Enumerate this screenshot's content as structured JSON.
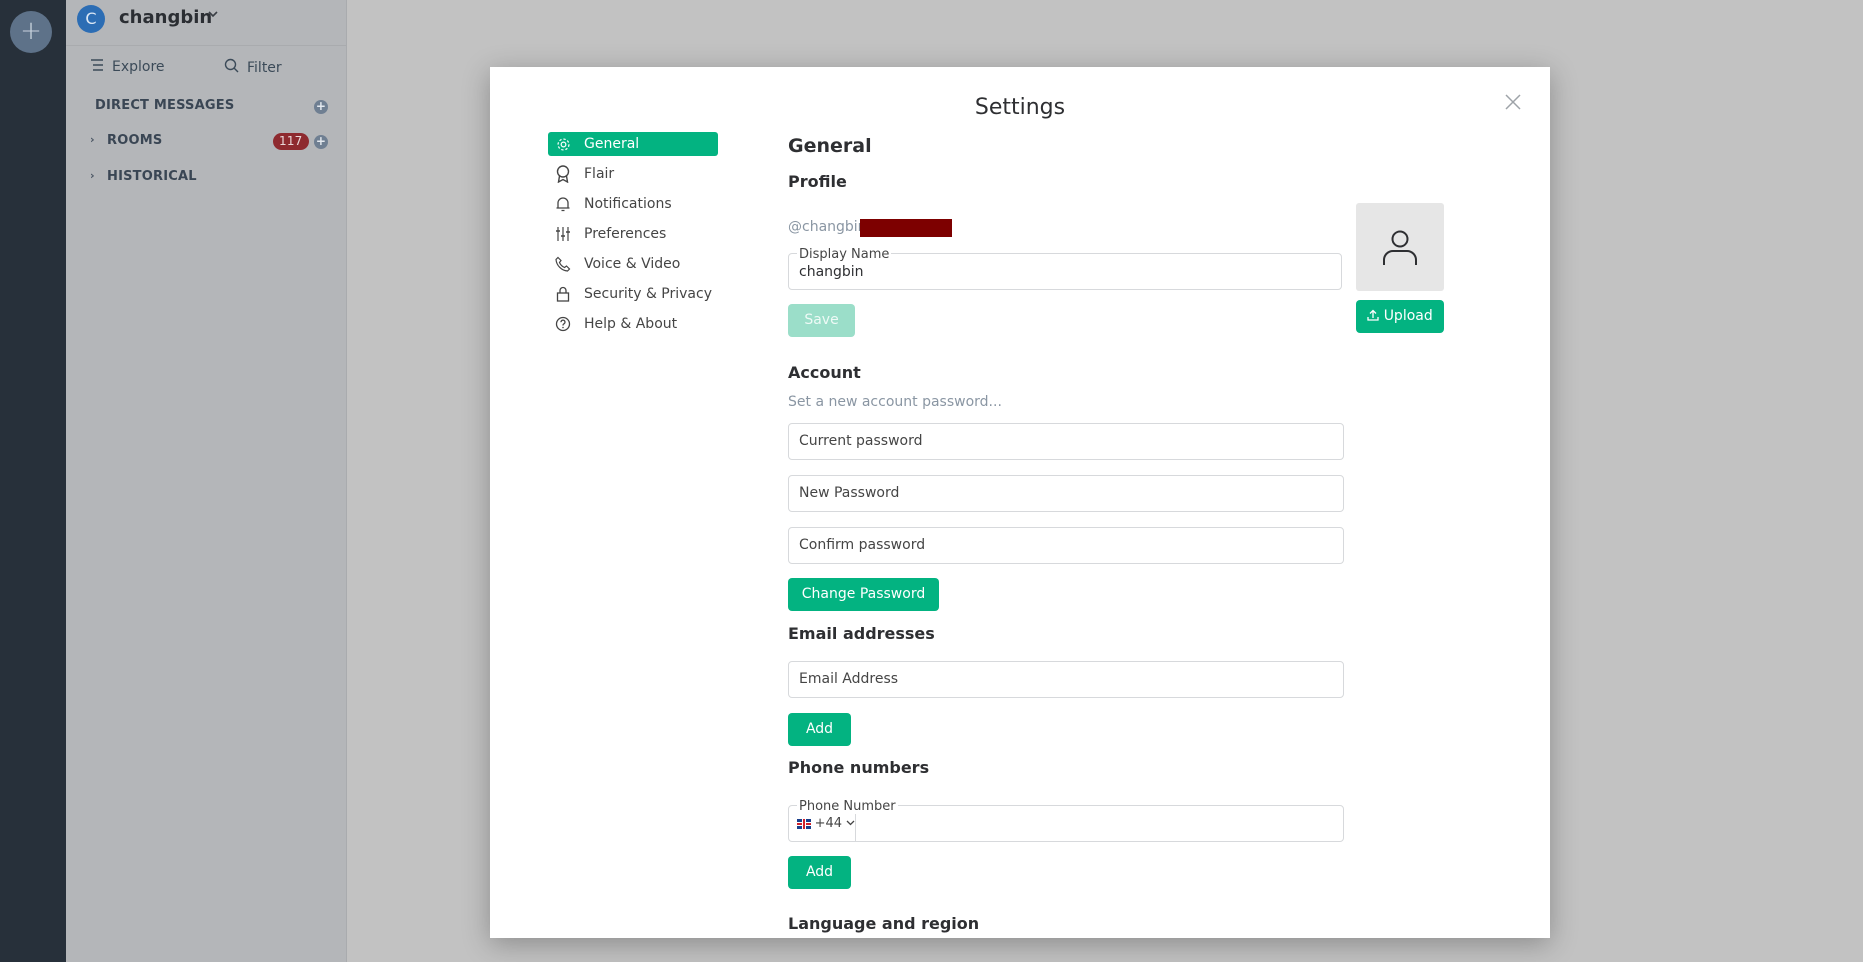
{
  "rail": {
    "add_label": "+"
  },
  "sidebar": {
    "avatar_letter": "C",
    "username": "changbin",
    "explore_label": "Explore",
    "filter_label": "Filter",
    "sections": [
      {
        "label": "DIRECT MESSAGES"
      },
      {
        "label": "ROOMS",
        "badge": "117"
      },
      {
        "label": "HISTORICAL"
      }
    ]
  },
  "modal": {
    "title": "Settings",
    "tabs": [
      {
        "label": "General",
        "icon": "gear-icon",
        "active": true
      },
      {
        "label": "Flair",
        "icon": "ribbon-icon"
      },
      {
        "label": "Notifications",
        "icon": "bell-icon"
      },
      {
        "label": "Preferences",
        "icon": "sliders-icon"
      },
      {
        "label": "Voice & Video",
        "icon": "phone-icon"
      },
      {
        "label": "Security & Privacy",
        "icon": "lock-icon"
      },
      {
        "label": "Help & About",
        "icon": "help-icon"
      }
    ],
    "general": {
      "heading": "General",
      "profile": {
        "heading": "Profile",
        "user_id": "@changbin",
        "display_name_label": "Display Name",
        "display_name_value": "changbin",
        "save_label": "Save",
        "upload_label": "Upload"
      },
      "account": {
        "heading": "Account",
        "hint": "Set a new account password...",
        "current_password_placeholder": "Current password",
        "new_password_placeholder": "New Password",
        "confirm_password_placeholder": "Confirm password",
        "change_password_label": "Change Password"
      },
      "email": {
        "heading": "Email addresses",
        "placeholder": "Email Address",
        "add_label": "Add"
      },
      "phone": {
        "heading": "Phone numbers",
        "label": "Phone Number",
        "country_code": "+44",
        "add_label": "Add"
      },
      "language_heading": "Language and region"
    }
  },
  "colors": {
    "accent": "#03b381",
    "accent_disabled": "#9bdec9",
    "badge": "#ff4b55"
  }
}
